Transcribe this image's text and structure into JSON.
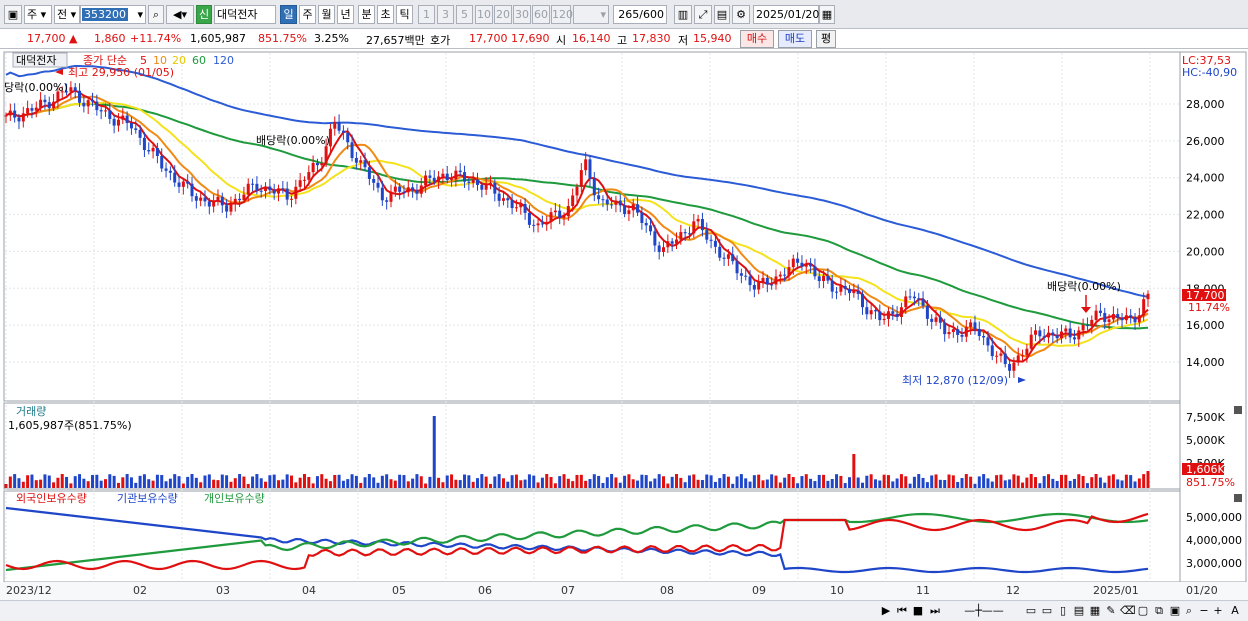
{
  "toolbar": {
    "market": "주",
    "range": "전",
    "code": "353200",
    "flag": "신",
    "name": "대덕전자",
    "periods": [
      "일",
      "주",
      "월",
      "년",
      "분",
      "초",
      "틱"
    ],
    "active_period": "일",
    "nums": [
      "1",
      "3",
      "5",
      "10",
      "20",
      "30",
      "60",
      "120"
    ],
    "count": "265",
    "count_total": "/600",
    "date": "2025/01/20"
  },
  "quote": {
    "price": "17,700 ▲",
    "change": "1,860",
    "change_pct": "+11.74%",
    "volume": "1,605,987",
    "volume_pct": "851.75%",
    "turnover_pct": "3.25%",
    "amount": "27,657백만",
    "ask_label": "호가",
    "ask": "17,700",
    "bid": "17,690",
    "open_label": "시",
    "open": "16,140",
    "high_label": "고",
    "high": "17,830",
    "low_label": "저",
    "low": "15,940",
    "buy": "매수",
    "sell": "매도",
    "eval": "평"
  },
  "price_panel": {
    "stock_name": "대덕전자",
    "ma_label": "종가 단순",
    "ma_periods": [
      "5",
      "10",
      "20",
      "60",
      "120"
    ],
    "lc": "LC:37,53",
    "hc": "HC:-40,90",
    "high_note": "최고 29,950 (01/05)",
    "low_note": "최저 12,870 (12/09)",
    "div_note": "배당락(0.00%)",
    "div_note_short": "당락(0.00%)",
    "div_note_mid": "배당락(0.00%)",
    "y_ticks": [
      "28,000",
      "26,000",
      "24,000",
      "22,000",
      "20,000",
      "18,000",
      "16,000",
      "14,000"
    ],
    "current_price": "17,700",
    "current_pct": "11.74%"
  },
  "volume_panel": {
    "title": "거래량",
    "value": "1,605,987주(851.75%)",
    "y_ticks": [
      "7,500K",
      "5,000K",
      "2,500K"
    ],
    "current": "1,606K",
    "current_pct": "851.75%"
  },
  "holding_panel": {
    "series": [
      "외국인보유수량",
      "기관보유수량",
      "개인보유수량"
    ],
    "y_ticks": [
      "5,000,000",
      "4,000,000",
      "3,000,000"
    ]
  },
  "x_axis": [
    "2023/12",
    "02",
    "03",
    "04",
    "05",
    "06",
    "07",
    "08",
    "09",
    "10",
    "11",
    "12",
    "2025/01",
    "01/20"
  ],
  "colors": {
    "ma5": "#e01010",
    "ma10": "#f08a14",
    "ma20": "#f3e21c",
    "ma60": "#1f9a3c",
    "ma120": "#2b5cd6",
    "up": "#e01010",
    "down": "#1f46c8"
  }
}
